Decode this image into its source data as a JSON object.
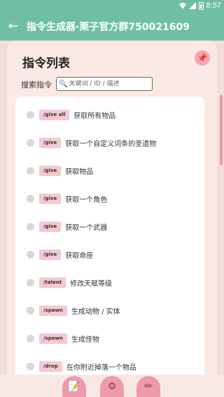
{
  "status_bar": {
    "time": "8:57"
  },
  "app_bar": {
    "back_icon": "arrow-left-icon",
    "title": "指令生成器·栗子官方群750021609"
  },
  "page": {
    "heading": "指令列表",
    "pin_icon": "pushpin-icon",
    "search_label": "搜索指令",
    "search_placeholder": "关键词 / ID / 描述",
    "search_value": ""
  },
  "commands": [
    {
      "cmd": "/give all",
      "desc": "获取所有物品"
    },
    {
      "cmd": "/give",
      "desc": "获取一个自定义词条的圣遗物"
    },
    {
      "cmd": "/give",
      "desc": "获取物品"
    },
    {
      "cmd": "/give",
      "desc": "获取一个角色"
    },
    {
      "cmd": "/give",
      "desc": "获取一个武器"
    },
    {
      "cmd": "/give",
      "desc": "获取命座"
    },
    {
      "cmd": "/talent",
      "desc": "修改天赋等级"
    },
    {
      "cmd": "/spawn",
      "desc": "生成动物 / 实体"
    },
    {
      "cmd": "/spawn",
      "desc": "生成怪物"
    },
    {
      "cmd": "/drop",
      "desc": "在你附近掉落一个物品"
    }
  ],
  "bottom_nav": [
    {
      "icon": "notepad-icon"
    },
    {
      "icon": "gear-icon"
    },
    {
      "icon": "pencil-icon"
    }
  ],
  "colors": {
    "accent": "#6fbfa6",
    "badge": "#f6c9cf",
    "fab": "#ee9aab"
  }
}
